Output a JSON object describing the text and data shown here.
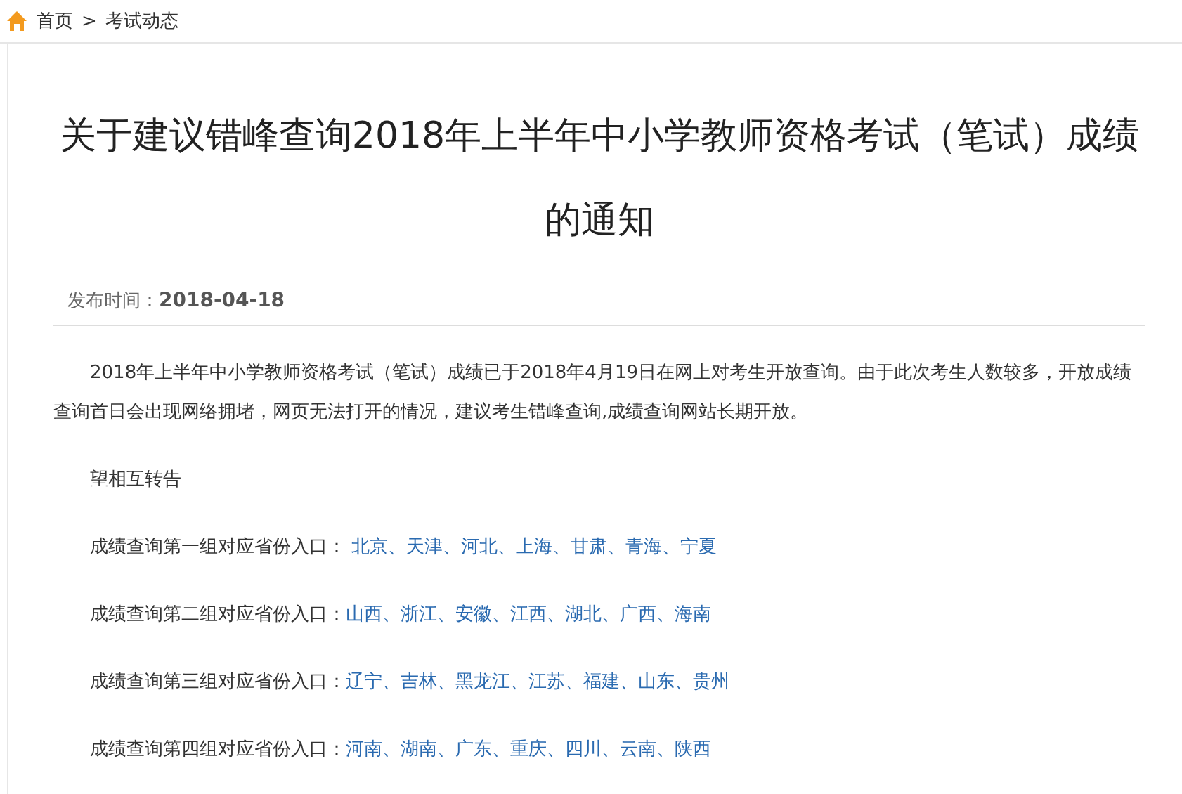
{
  "breadcrumb": {
    "items": [
      {
        "label": "首页"
      },
      {
        "label": "考试动态"
      }
    ],
    "separator": ">"
  },
  "article": {
    "title": "关于建议错峰查询2018年上半年中小学教师资格考试（笔试）成绩的通知",
    "publish_label": "发布时间：",
    "publish_date": "2018-04-18",
    "paragraphs": [
      "2018年上半年中小学教师资格考试（笔试）成绩已于2018年4月19日在网上对考生开放查询。由于此次考生人数较多，开放成绩查询首日会出现网络拥堵，网页无法打开的情况，建议考生错峰查询,成绩查询网站长期开放。",
      "望相互转告"
    ],
    "groups": [
      {
        "label": "成绩查询第一组对应省份入口：",
        "links": " 北京、天津、河北、上海、甘肃、青海、宁夏"
      },
      {
        "label": "成绩查询第二组对应省份入口：",
        "links": "山西、浙江、安徽、江西、湖北、广西、海南"
      },
      {
        "label": "成绩查询第三组对应省份入口：",
        "links": "辽宁、吉林、黑龙江、江苏、福建、山东、贵州"
      },
      {
        "label": "成绩查询第四组对应省份入口：",
        "links": "河南、湖南、广东、重庆、四川、云南、陕西"
      }
    ]
  }
}
